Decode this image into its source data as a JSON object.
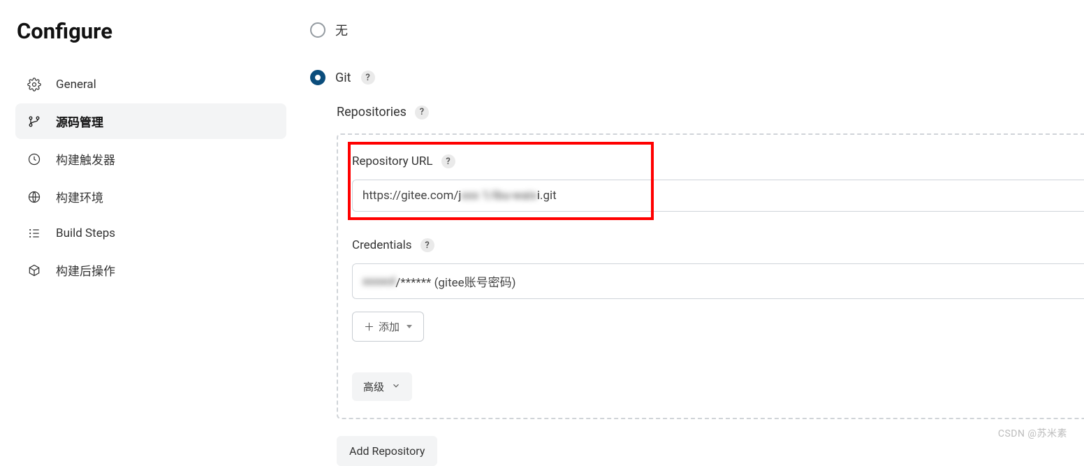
{
  "page": {
    "title": "Configure"
  },
  "sidebar": {
    "items": [
      {
        "label": "General"
      },
      {
        "label": "源码管理"
      },
      {
        "label": "构建触发器"
      },
      {
        "label": "构建环境"
      },
      {
        "label": "Build Steps"
      },
      {
        "label": "构建后操作"
      }
    ]
  },
  "scm": {
    "none_label": "无",
    "git_label": "Git",
    "repositories_label": "Repositories",
    "repo_url_label": "Repository URL",
    "repo_url_value_prefix": "https://gitee.com/j",
    "repo_url_value_blur": "xxx 1/ibu-waix",
    "repo_url_value_suffix": "i.git",
    "credentials_label": "Credentials",
    "credentials_value_blur": "xxxxol",
    "credentials_value_suffix": "/****** (gitee账号密码)",
    "add_button": "添加",
    "advanced_button": "高级",
    "add_repository_button": "Add Repository"
  },
  "watermark": "CSDN @苏米素"
}
